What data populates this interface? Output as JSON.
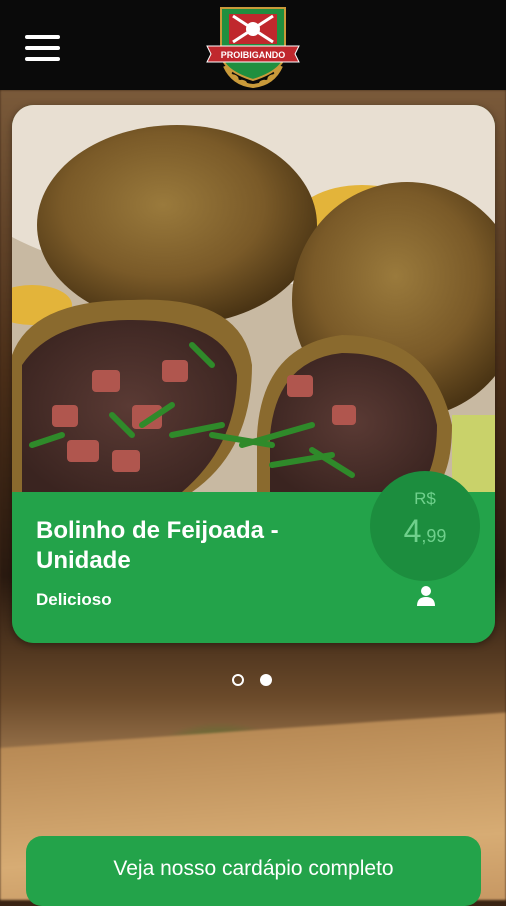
{
  "header": {
    "logo_text": "PROIBIGANDO",
    "menu_icon": "hamburger-menu-icon"
  },
  "slide": {
    "product_name": "Bolinho de Feijoada - Unidade",
    "description": "Delicioso",
    "price": {
      "currency": "R$",
      "whole": "4",
      "cents": ",99"
    },
    "user_icon": "user-icon",
    "colors": {
      "card_green": "#23a34a",
      "badge_green": "#1c8d3e",
      "price_text": "#6fd08c"
    }
  },
  "carousel": {
    "slides": 2,
    "active": 2
  },
  "cta": {
    "label": "Veja nosso cardápio completo"
  }
}
